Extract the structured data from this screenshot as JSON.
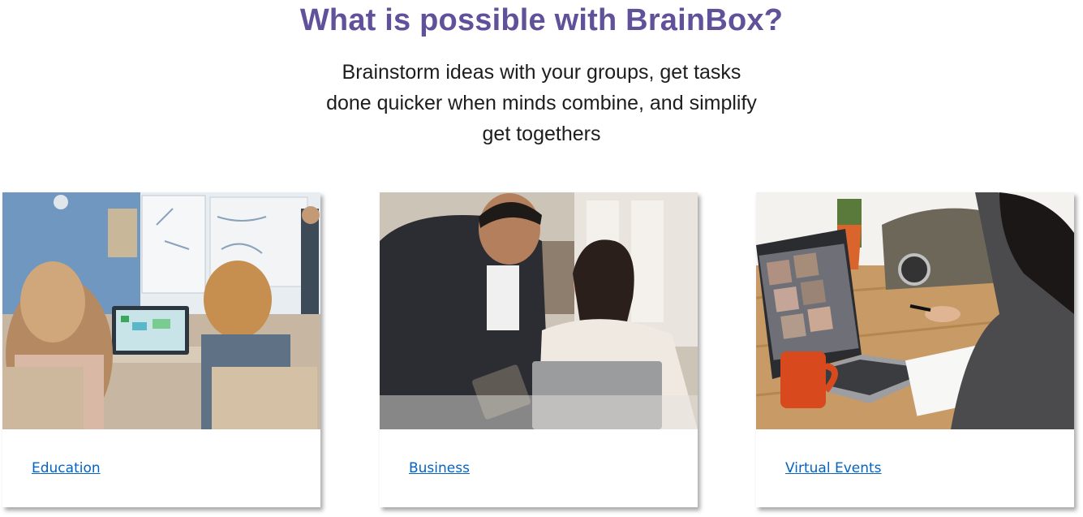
{
  "hero": {
    "title": "What is possible with BrainBox?",
    "subtitle_lines": [
      "Brainstorm ideas with your groups, get tasks",
      "done quicker when minds combine, and simplify",
      "get togethers"
    ]
  },
  "colors": {
    "title": "#60519a",
    "link": "#0563c1",
    "text": "#1d1d1d"
  },
  "cards": [
    {
      "link_label": "Education",
      "image": "classroom-photo"
    },
    {
      "link_label": "Business",
      "image": "office-meeting-photo"
    },
    {
      "link_label": "Virtual Events",
      "image": "video-call-photo"
    }
  ]
}
